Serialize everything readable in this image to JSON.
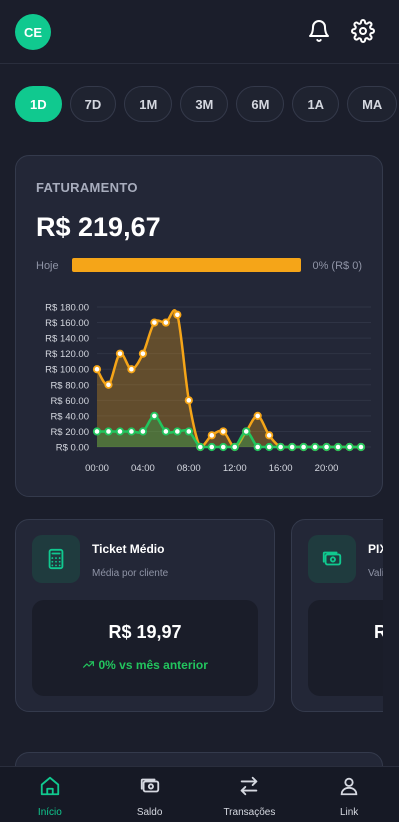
{
  "header": {
    "avatar_initials": "CE",
    "icons": [
      "bell-icon",
      "gear-icon"
    ]
  },
  "periods": [
    {
      "label": "1D",
      "active": true
    },
    {
      "label": "7D",
      "active": false
    },
    {
      "label": "1M",
      "active": false
    },
    {
      "label": "3M",
      "active": false
    },
    {
      "label": "6M",
      "active": false
    },
    {
      "label": "1A",
      "active": false
    },
    {
      "label": "MA",
      "active": false
    }
  ],
  "faturamento": {
    "title": "FATURAMENTO",
    "value": "R$ 219,67",
    "progress_label": "Hoje",
    "progress_fraction": 1.0,
    "progress_text": "0% (R$ 0)",
    "progress_color": "#f5a518"
  },
  "chart_data": {
    "type": "line",
    "title": "",
    "xlabel": "",
    "ylabel": "",
    "ylim": [
      0,
      180
    ],
    "yticks": [
      "R$ 180.00",
      "R$ 160.00",
      "R$ 140.00",
      "R$ 120.00",
      "R$ 100.00",
      "R$ 80.00",
      "R$ 60.00",
      "R$ 40.00",
      "R$ 20.00",
      "R$ 0.00"
    ],
    "ytick_values": [
      180,
      160,
      140,
      120,
      100,
      80,
      60,
      40,
      20,
      0
    ],
    "xticks": [
      "00:00",
      "04:00",
      "08:00",
      "12:00",
      "16:00",
      "20:00"
    ],
    "xtick_hours": [
      0,
      4,
      8,
      12,
      16,
      20
    ],
    "x": [
      0,
      1,
      2,
      3,
      4,
      5,
      6,
      7,
      8,
      9,
      10,
      11,
      12,
      13,
      14,
      15,
      16,
      17,
      18,
      19,
      20,
      21,
      22,
      23
    ],
    "series": [
      {
        "color": "#f5a518",
        "values": [
          100,
          80,
          120,
          100,
          120,
          160,
          160,
          170,
          60,
          0,
          15,
          20,
          0,
          20,
          40,
          15,
          0,
          0,
          0,
          0,
          0,
          0,
          0,
          0
        ]
      },
      {
        "color": "#22c55e",
        "values": [
          20,
          20,
          20,
          20,
          20,
          40,
          20,
          20,
          20,
          0,
          0,
          0,
          0,
          20,
          0,
          0,
          0,
          0,
          0,
          0,
          0,
          0,
          0,
          0
        ]
      }
    ],
    "grid": true
  },
  "cards": [
    {
      "icon": "calculator-icon",
      "title": "Ticket Médio",
      "subtitle": "Média por cliente",
      "value": "R$ 19,97",
      "trend": "0% vs mês anterior"
    },
    {
      "icon": "cash-icon",
      "title": "PIX",
      "subtitle": "Vali",
      "value": "R"
    }
  ],
  "nav": [
    {
      "label": "Início",
      "icon": "home-icon",
      "active": true
    },
    {
      "label": "Saldo",
      "icon": "wallet-icon",
      "active": false
    },
    {
      "label": "Transações",
      "icon": "transfer-icon",
      "active": false
    },
    {
      "label": "Link",
      "icon": "user-icon",
      "active": false
    }
  ]
}
